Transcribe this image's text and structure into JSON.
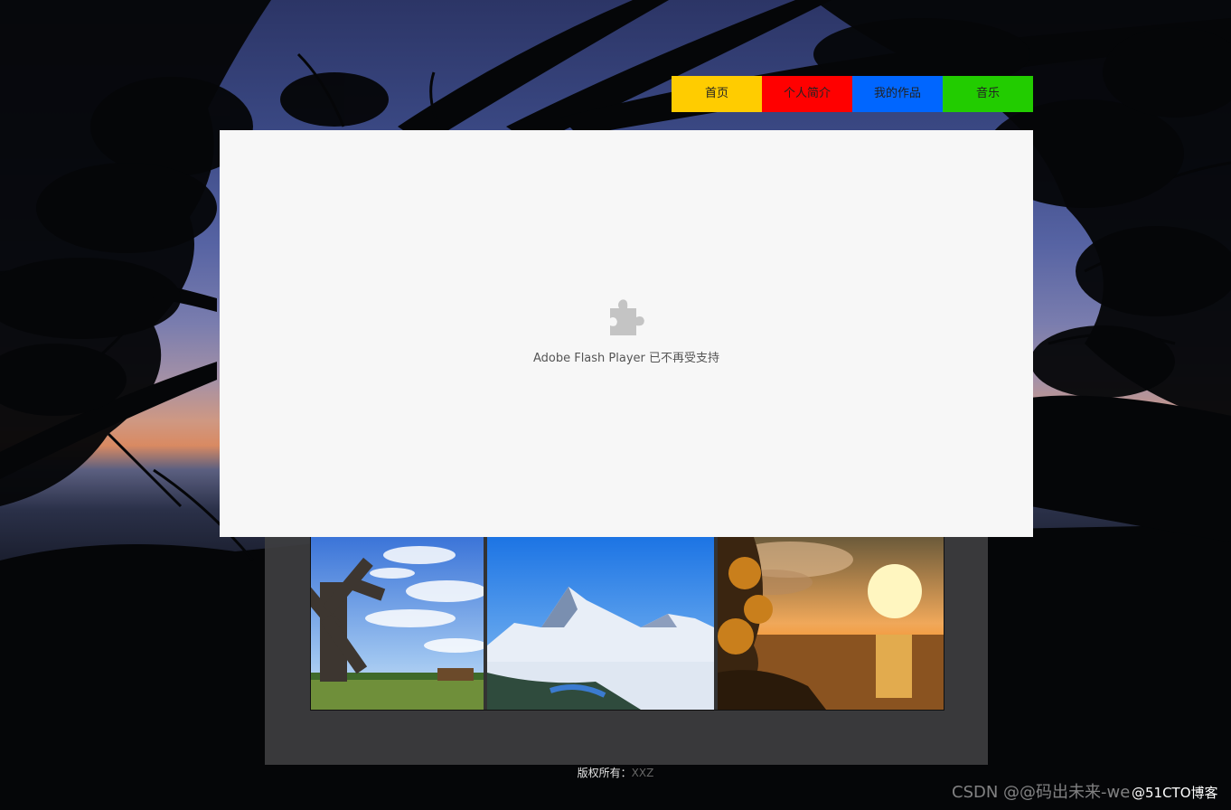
{
  "nav": {
    "items": [
      {
        "label": "首页",
        "color": "#ffcc00"
      },
      {
        "label": "个人简介",
        "color": "#ff0000"
      },
      {
        "label": "我的作品",
        "color": "#0066ff"
      },
      {
        "label": "音乐",
        "color": "#22cc00"
      }
    ]
  },
  "flash": {
    "icon": "puzzle-piece-icon",
    "message": "Adobe Flash Player 已不再受支持"
  },
  "gallery": {
    "images": [
      {
        "subject": "windmill-meadow-photo"
      },
      {
        "subject": "snowy-mountains-photo"
      },
      {
        "subject": "sunset-sea-photo"
      }
    ]
  },
  "footer": {
    "label": "版权所有：",
    "owner": "XXZ"
  },
  "watermark": {
    "csdn": "CSDN @@码出未来-we",
    "cto": "@51CTO博客"
  },
  "colors": {
    "flash_bg": "#f7f7f7",
    "panel_bg": "#3e3e40"
  }
}
